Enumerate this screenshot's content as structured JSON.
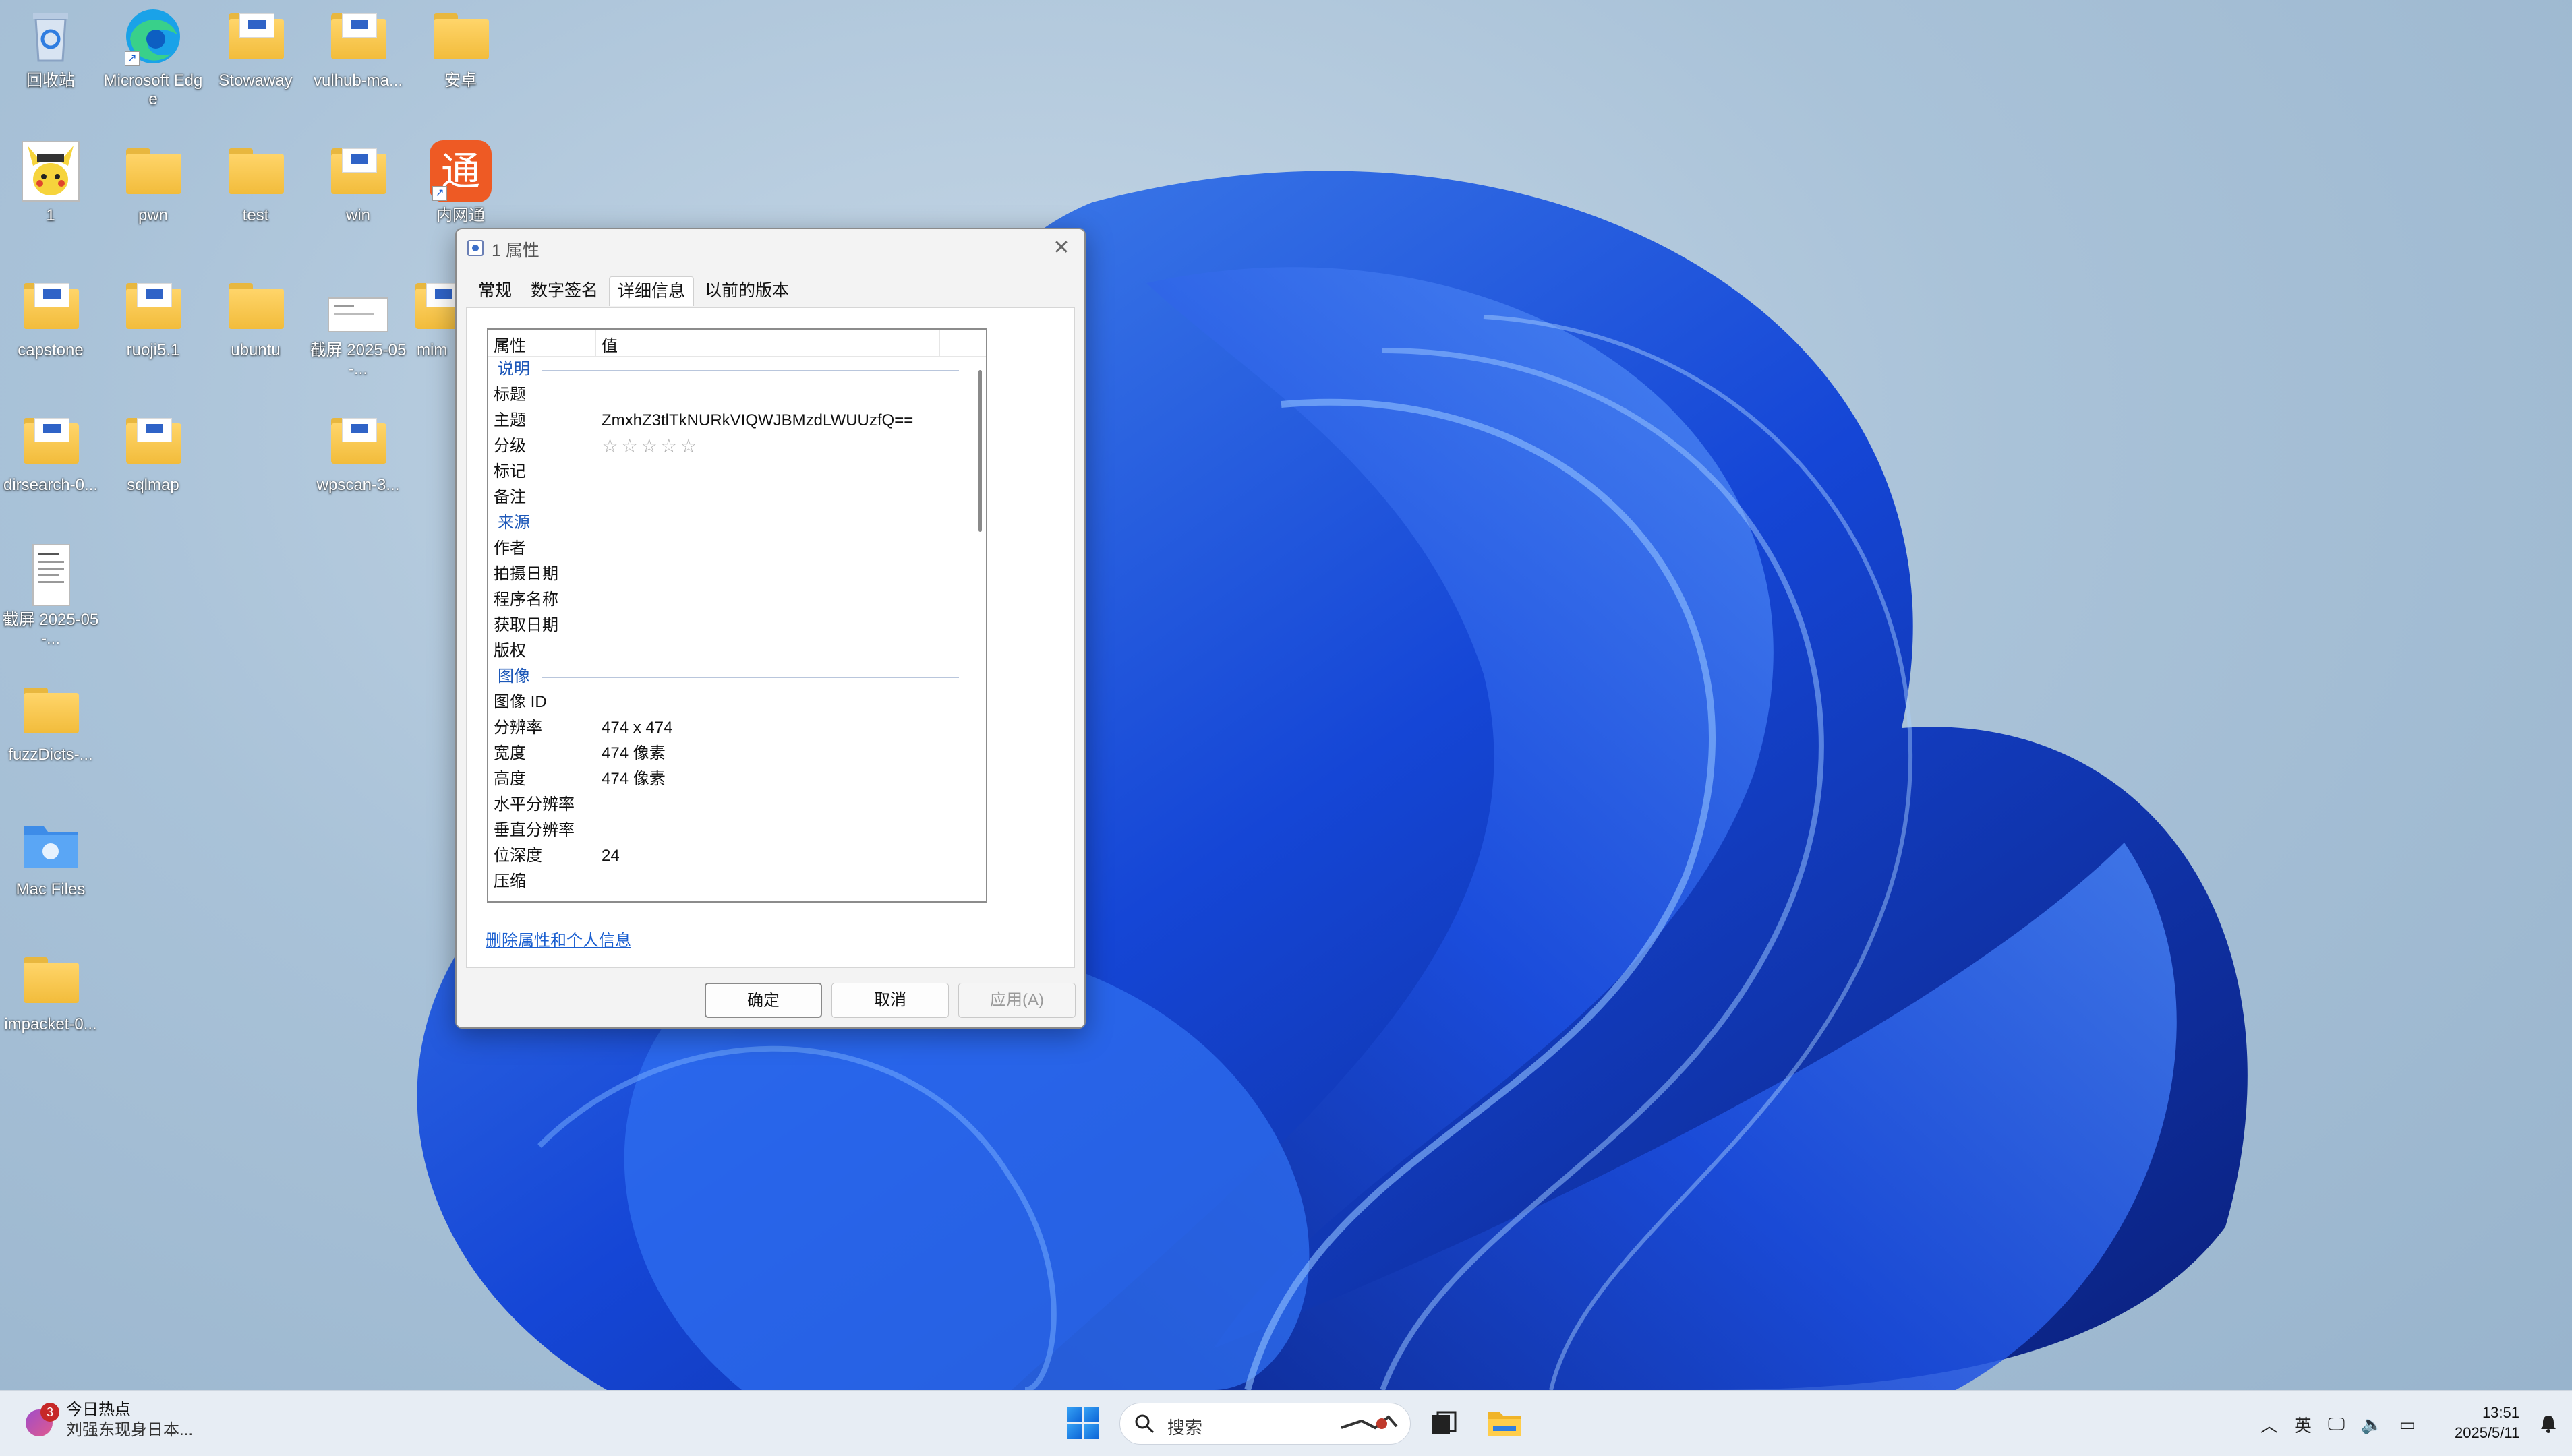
{
  "desktop": {
    "icons": [
      {
        "label": "回收站",
        "kind": "recycle-bin"
      },
      {
        "label": "Microsoft Edge",
        "kind": "edge"
      },
      {
        "label": "Stowaway",
        "kind": "folder"
      },
      {
        "label": "vulhub-ma...",
        "kind": "folder"
      },
      {
        "label": "安卓",
        "kind": "folder"
      },
      {
        "label": "1",
        "kind": "image-file"
      },
      {
        "label": "pwn",
        "kind": "folder"
      },
      {
        "label": "test",
        "kind": "folder"
      },
      {
        "label": "win",
        "kind": "folder"
      },
      {
        "label": "内网通",
        "kind": "app"
      },
      {
        "label": "capstone",
        "kind": "folder"
      },
      {
        "label": "ruoji5.1",
        "kind": "folder"
      },
      {
        "label": "ubuntu",
        "kind": "folder"
      },
      {
        "label": "截屏 2025-05-...",
        "kind": "screenshot"
      },
      {
        "label": "mim",
        "kind": "folder"
      },
      {
        "label": "dirsearch-0...",
        "kind": "folder"
      },
      {
        "label": "sqlmap",
        "kind": "folder"
      },
      {
        "label": "wpscan-3...",
        "kind": "folder"
      },
      {
        "label": "截屏 2025-05-...",
        "kind": "document"
      },
      {
        "label": "fuzzDicts-...",
        "kind": "folder"
      },
      {
        "label": "Mac Files",
        "kind": "mac-folder"
      },
      {
        "label": "impacket-0...",
        "kind": "folder"
      }
    ]
  },
  "dialog": {
    "title": "1 属性",
    "tabs": [
      "常规",
      "数字签名",
      "详细信息",
      "以前的版本"
    ],
    "active_tab": "详细信息",
    "columns": {
      "property": "属性",
      "value": "值"
    },
    "sections": {
      "description": "说明",
      "origin": "来源",
      "image": "图像"
    },
    "rows": {
      "title": {
        "k": "标题",
        "v": ""
      },
      "subject": {
        "k": "主题",
        "v": "ZmxhZ3tlTkNURkVIQWJBMzdLWUUzfQ=="
      },
      "rating": {
        "k": "分级",
        "v": "☆☆☆☆☆"
      },
      "tags": {
        "k": "标记",
        "v": ""
      },
      "comments": {
        "k": "备注",
        "v": ""
      },
      "author": {
        "k": "作者",
        "v": ""
      },
      "date_taken": {
        "k": "拍摄日期",
        "v": ""
      },
      "program": {
        "k": "程序名称",
        "v": ""
      },
      "date_acquired": {
        "k": "获取日期",
        "v": ""
      },
      "copyright": {
        "k": "版权",
        "v": ""
      },
      "image_id": {
        "k": "图像 ID",
        "v": ""
      },
      "dimensions": {
        "k": "分辨率",
        "v": "474 x 474"
      },
      "width": {
        "k": "宽度",
        "v": "474 像素"
      },
      "height": {
        "k": "高度",
        "v": "474 像素"
      },
      "hres": {
        "k": "水平分辨率",
        "v": ""
      },
      "vres": {
        "k": "垂直分辨率",
        "v": ""
      },
      "bit_depth": {
        "k": "位深度",
        "v": "24"
      },
      "compression": {
        "k": "压缩",
        "v": ""
      }
    },
    "remove_link": "删除属性和个人信息",
    "buttons": {
      "ok": "确定",
      "cancel": "取消",
      "apply": "应用(A)"
    }
  },
  "taskbar": {
    "news": {
      "badge": "3",
      "title": "今日热点",
      "subtitle": "刘强东现身日本..."
    },
    "search_placeholder": "搜索",
    "ime": "英",
    "time": "13:51",
    "date": "2025/5/11"
  },
  "colors": {
    "accent": "#1a5fd0",
    "section_text": "#1c57b8",
    "taskbar": "#e7edf4"
  }
}
